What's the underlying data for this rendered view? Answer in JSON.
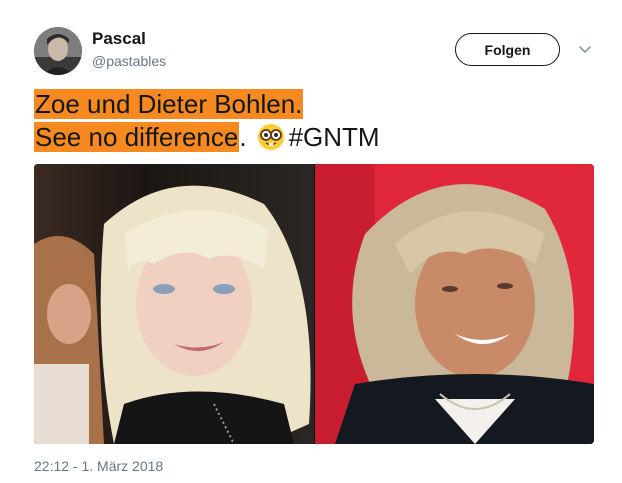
{
  "tweet": {
    "user": {
      "name": "Pascal",
      "handle": "@pastables"
    },
    "follow_label": "Folgen",
    "text": {
      "line1": "Zoe und Dieter Bohlen.",
      "line2_highlight": "See no difference",
      "line2_period": ".",
      "hashtag": "#GNTM"
    },
    "emoji": "nerd-face-emoji",
    "timestamp": "22:12 - 1. März 2018"
  },
  "colors": {
    "highlight": "#f6891f",
    "secondary_text": "#657786",
    "primary_text": "#14171a"
  },
  "icons": [
    "chevron-down-icon",
    "nerd-face-emoji"
  ]
}
